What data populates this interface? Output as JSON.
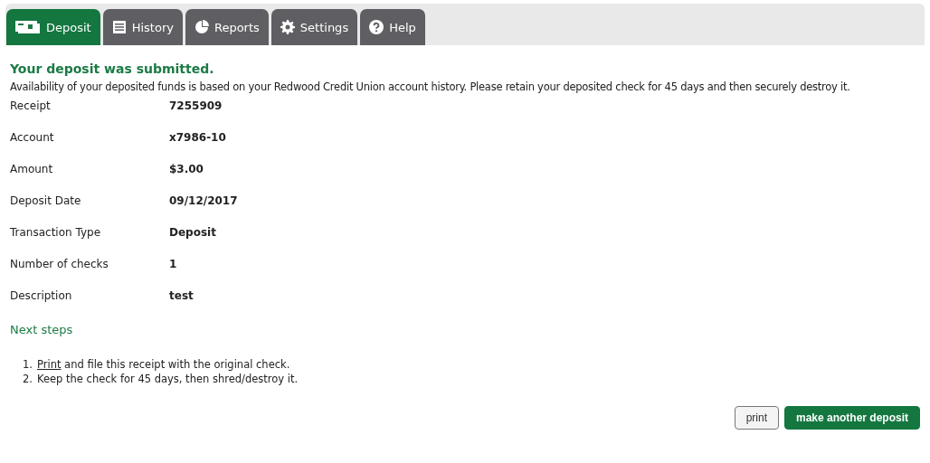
{
  "tabs": [
    {
      "label": "Deposit",
      "kind": "check",
      "selected": true
    },
    {
      "label": "History",
      "kind": "list",
      "selected": false
    },
    {
      "label": "Reports",
      "kind": "pie",
      "selected": false
    },
    {
      "label": "Settings",
      "kind": "gear",
      "selected": false
    },
    {
      "label": "Help",
      "kind": "help",
      "selected": false
    }
  ],
  "heading": "Your deposit was submitted.",
  "notice": "Availability of your deposited funds is based on your Redwood Credit Union account history. Please retain your deposited check for 45 days and then securely destroy it.",
  "details": [
    {
      "label": "Receipt",
      "value": "7255909"
    },
    {
      "label": "Account",
      "value": "x7986-10"
    },
    {
      "label": "Amount",
      "value": "$3.00"
    },
    {
      "label": "Deposit Date",
      "value": "09/12/2017"
    },
    {
      "label": "Transaction Type",
      "value": "Deposit"
    },
    {
      "label": "Number of checks",
      "value": "1"
    },
    {
      "label": "Description",
      "value": "test"
    }
  ],
  "next_steps_title": "Next steps",
  "steps": [
    {
      "number": "1.",
      "link": "Print",
      "text": " and file this receipt with the original check."
    },
    {
      "number": "2.",
      "text": "Keep the check for 45 days, then shred/destroy it."
    }
  ],
  "buttons": [
    {
      "label": "print",
      "kind": "secondary"
    },
    {
      "label": "make another deposit",
      "kind": "primary"
    }
  ]
}
